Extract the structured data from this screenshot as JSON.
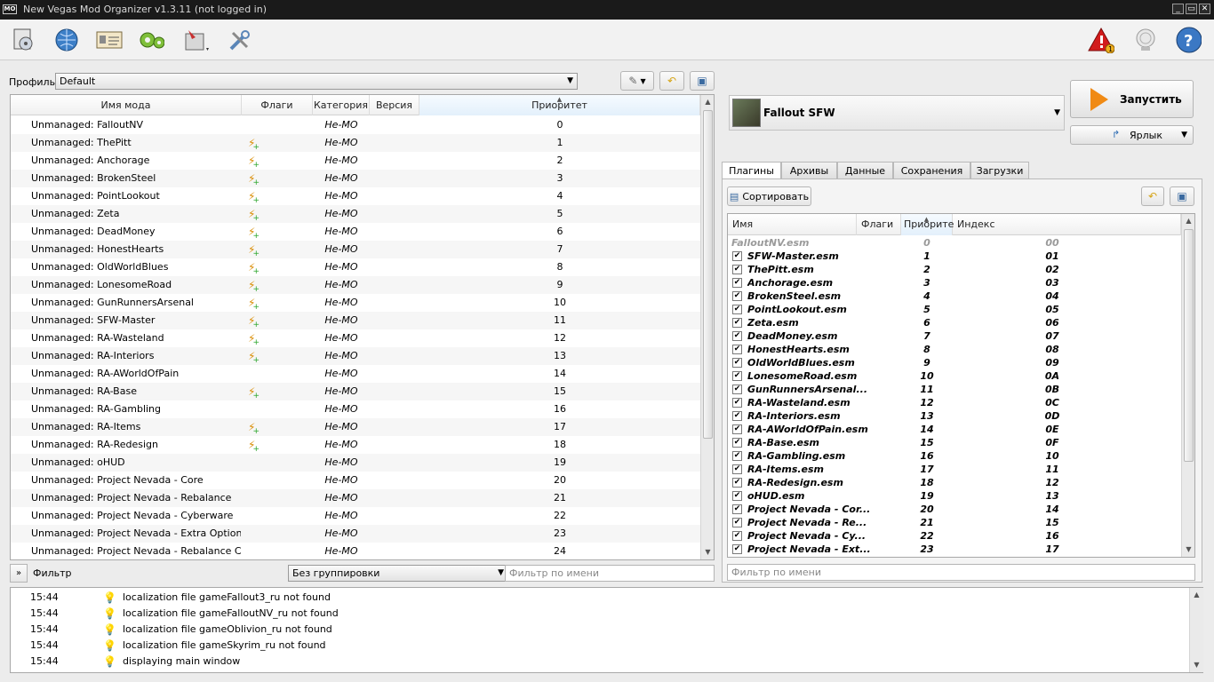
{
  "window": {
    "title": "New Vegas Mod Organizer v1.3.11 (not logged in)",
    "app_icon": "MO",
    "min": "_",
    "max": "▭",
    "close": "✕"
  },
  "toolbar": {
    "left_icons": [
      "install-mod-icon",
      "nexus-icon",
      "profiles-icon",
      "executables-icon",
      "tools-icon",
      "settings-icon"
    ],
    "right_icons": [
      "problems-icon",
      "update-icon",
      "help-icon"
    ],
    "problems_count": "1"
  },
  "profile": {
    "label": "Профиль",
    "value": "Default"
  },
  "modlist": {
    "columns": [
      "Имя мода",
      "Флаги",
      "Категория",
      "Версия",
      "Приоритет"
    ],
    "rows": [
      {
        "name": "Unmanaged: FalloutNV",
        "flag": false,
        "category": "Не-МО",
        "priority": "0"
      },
      {
        "name": "Unmanaged: ThePitt",
        "flag": true,
        "category": "Не-МО",
        "priority": "1"
      },
      {
        "name": "Unmanaged: Anchorage",
        "flag": true,
        "category": "Не-МО",
        "priority": "2"
      },
      {
        "name": "Unmanaged: BrokenSteel",
        "flag": true,
        "category": "Не-МО",
        "priority": "3"
      },
      {
        "name": "Unmanaged: PointLookout",
        "flag": true,
        "category": "Не-МО",
        "priority": "4"
      },
      {
        "name": "Unmanaged: Zeta",
        "flag": true,
        "category": "Не-МО",
        "priority": "5"
      },
      {
        "name": "Unmanaged: DeadMoney",
        "flag": true,
        "category": "Не-МО",
        "priority": "6"
      },
      {
        "name": "Unmanaged: HonestHearts",
        "flag": true,
        "category": "Не-МО",
        "priority": "7"
      },
      {
        "name": "Unmanaged: OldWorldBlues",
        "flag": true,
        "category": "Не-МО",
        "priority": "8"
      },
      {
        "name": "Unmanaged: LonesomeRoad",
        "flag": true,
        "category": "Не-МО",
        "priority": "9"
      },
      {
        "name": "Unmanaged: GunRunnersArsenal",
        "flag": true,
        "category": "Не-МО",
        "priority": "10"
      },
      {
        "name": "Unmanaged: SFW-Master",
        "flag": true,
        "category": "Не-МО",
        "priority": "11"
      },
      {
        "name": "Unmanaged: RA-Wasteland",
        "flag": true,
        "category": "Не-МО",
        "priority": "12"
      },
      {
        "name": "Unmanaged: RA-Interiors",
        "flag": true,
        "category": "Не-МО",
        "priority": "13"
      },
      {
        "name": "Unmanaged: RA-AWorldOfPain",
        "flag": false,
        "category": "Не-МО",
        "priority": "14"
      },
      {
        "name": "Unmanaged: RA-Base",
        "flag": true,
        "category": "Не-МО",
        "priority": "15"
      },
      {
        "name": "Unmanaged: RA-Gambling",
        "flag": false,
        "category": "Не-МО",
        "priority": "16"
      },
      {
        "name": "Unmanaged: RA-Items",
        "flag": true,
        "category": "Не-МО",
        "priority": "17"
      },
      {
        "name": "Unmanaged: RA-Redesign",
        "flag": true,
        "category": "Не-МО",
        "priority": "18"
      },
      {
        "name": "Unmanaged: oHUD",
        "flag": false,
        "category": "Не-МО",
        "priority": "19"
      },
      {
        "name": "Unmanaged: Project Nevada - Core",
        "flag": false,
        "category": "Не-МО",
        "priority": "20"
      },
      {
        "name": "Unmanaged: Project Nevada - Rebalance",
        "flag": false,
        "category": "Не-МО",
        "priority": "21"
      },
      {
        "name": "Unmanaged: Project Nevada - Cyberware",
        "flag": false,
        "category": "Не-МО",
        "priority": "22"
      },
      {
        "name": "Unmanaged: Project Nevada - Extra Options",
        "flag": false,
        "category": "Не-МО",
        "priority": "23"
      },
      {
        "name": "Unmanaged: Project Nevada - Rebalance C...",
        "flag": false,
        "category": "Не-МО",
        "priority": "24"
      }
    ]
  },
  "filter": {
    "toggle": "»",
    "label": "Фильтр",
    "grouping": "Без группировки",
    "name_placeholder": "Фильтр по имени"
  },
  "game": {
    "name": "Fallout SFW"
  },
  "run": {
    "label": "Запустить"
  },
  "shortcut": {
    "label": "Ярлык"
  },
  "tabs": [
    "Плагины",
    "Архивы",
    "Данные",
    "Сохранения",
    "Загрузки"
  ],
  "plugins": {
    "sort_label": "Сортировать",
    "columns": [
      "Имя",
      "Флаги",
      "Приорите",
      "Индекс"
    ],
    "filter_placeholder": "Фильтр по имени",
    "rows": [
      {
        "name": "FalloutNV.esm",
        "priority": "0",
        "index": "00",
        "disabled": true
      },
      {
        "name": "SFW-Master.esm",
        "priority": "1",
        "index": "01"
      },
      {
        "name": "ThePitt.esm",
        "priority": "2",
        "index": "02"
      },
      {
        "name": "Anchorage.esm",
        "priority": "3",
        "index": "03"
      },
      {
        "name": "BrokenSteel.esm",
        "priority": "4",
        "index": "04"
      },
      {
        "name": "PointLookout.esm",
        "priority": "5",
        "index": "05"
      },
      {
        "name": "Zeta.esm",
        "priority": "6",
        "index": "06"
      },
      {
        "name": "DeadMoney.esm",
        "priority": "7",
        "index": "07"
      },
      {
        "name": "HonestHearts.esm",
        "priority": "8",
        "index": "08"
      },
      {
        "name": "OldWorldBlues.esm",
        "priority": "9",
        "index": "09"
      },
      {
        "name": "LonesomeRoad.esm",
        "priority": "10",
        "index": "0A"
      },
      {
        "name": "GunRunnersArsenal...",
        "priority": "11",
        "index": "0B"
      },
      {
        "name": "RA-Wasteland.esm",
        "priority": "12",
        "index": "0C"
      },
      {
        "name": "RA-Interiors.esm",
        "priority": "13",
        "index": "0D"
      },
      {
        "name": "RA-AWorldOfPain.esm",
        "priority": "14",
        "index": "0E"
      },
      {
        "name": "RA-Base.esm",
        "priority": "15",
        "index": "0F"
      },
      {
        "name": "RA-Gambling.esm",
        "priority": "16",
        "index": "10"
      },
      {
        "name": "RA-Items.esm",
        "priority": "17",
        "index": "11"
      },
      {
        "name": "RA-Redesign.esm",
        "priority": "18",
        "index": "12"
      },
      {
        "name": "oHUD.esm",
        "priority": "19",
        "index": "13"
      },
      {
        "name": "Project Nevada - Cor...",
        "priority": "20",
        "index": "14"
      },
      {
        "name": "Project Nevada - Re...",
        "priority": "21",
        "index": "15"
      },
      {
        "name": "Project Nevada - Cy...",
        "priority": "22",
        "index": "16"
      },
      {
        "name": "Project Nevada - Ext...",
        "priority": "23",
        "index": "17"
      }
    ]
  },
  "log": [
    {
      "time": "15:44",
      "msg": "localization file gameFallout3_ru not found"
    },
    {
      "time": "15:44",
      "msg": "localization file gameFalloutNV_ru not found"
    },
    {
      "time": "15:44",
      "msg": "localization file gameOblivion_ru not found"
    },
    {
      "time": "15:44",
      "msg": "localization file gameSkyrim_ru not found"
    },
    {
      "time": "15:44",
      "msg": "displaying main window"
    }
  ]
}
